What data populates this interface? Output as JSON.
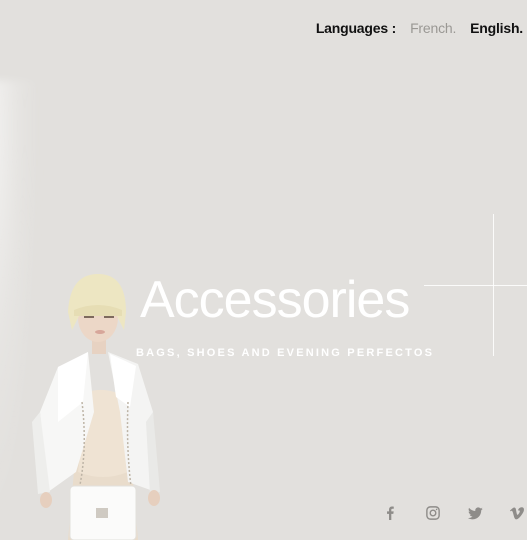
{
  "header": {
    "languages_label": "Languages :",
    "languages": [
      {
        "label": "French.",
        "active": false
      },
      {
        "label": "English.",
        "active": true
      }
    ]
  },
  "hero": {
    "title": "Accessories",
    "subtitle": "BAGS, SHOES AND EVENING PERFECTOS"
  },
  "social": {
    "icons": [
      "facebook-icon",
      "instagram-icon",
      "twitter-icon",
      "vimeo-icon"
    ]
  },
  "colors": {
    "background": "#e2e0dd",
    "text_dark": "#111111",
    "text_muted": "#9a9894",
    "hero_text": "#ffffff",
    "icon": "#8e8c89"
  }
}
